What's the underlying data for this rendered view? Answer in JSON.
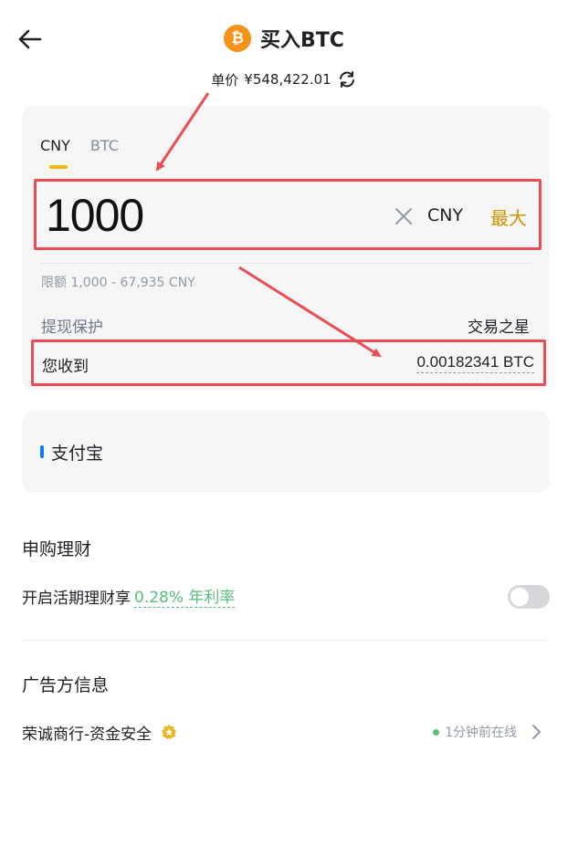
{
  "header": {
    "title": "买入BTC",
    "coin_symbol": "₿",
    "coin_color": "#f7931a"
  },
  "price": {
    "label": "单价",
    "value": "¥548,422.01"
  },
  "tabs": [
    {
      "label": "CNY",
      "active": true
    },
    {
      "label": "BTC",
      "active": false
    }
  ],
  "amount": {
    "value": "1000",
    "currency": "CNY",
    "max_label": "最大"
  },
  "limit": {
    "text": "限额 1,000 - 67,935 CNY"
  },
  "protection": {
    "label": "提现保护",
    "value": "交易之星"
  },
  "receive": {
    "label": "您收到",
    "value": "0.00182341 BTC"
  },
  "payment": {
    "method": "支付宝",
    "accent": "#1677ff"
  },
  "finance": {
    "section_title": "申购理财",
    "label": "开启活期理财享",
    "rate": "0.28% 年利率",
    "toggle_on": false
  },
  "advertiser": {
    "section_title": "广告方信息",
    "name": "荣诚商行-资金安全",
    "status": "1分钟前在线"
  },
  "colors": {
    "highlight_box": "#e94d55",
    "accent_yellow": "#f0b90b",
    "max_gold": "#c99400",
    "positive_green": "#58bd7d"
  }
}
